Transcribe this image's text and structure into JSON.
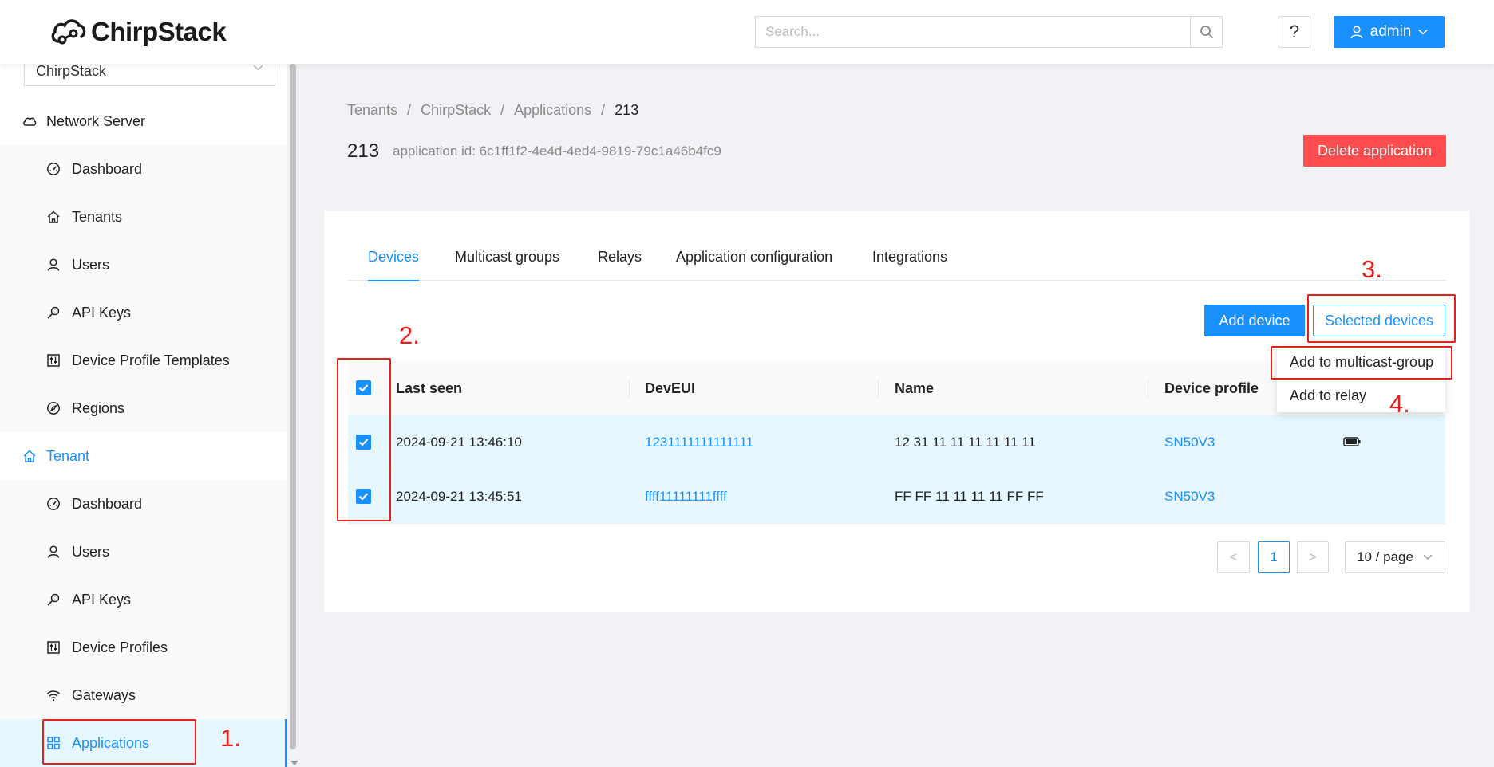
{
  "header": {
    "logo_text": "ChirpStack",
    "search_placeholder": "Search...",
    "help_label": "?",
    "user_label": "admin"
  },
  "sidebar": {
    "tenant_selector": "ChirpStack",
    "network_server_group": "Network Server",
    "network_server_items": [
      {
        "label": "Dashboard",
        "icon": "dashboard-icon"
      },
      {
        "label": "Tenants",
        "icon": "home-icon"
      },
      {
        "label": "Users",
        "icon": "user-icon"
      },
      {
        "label": "API Keys",
        "icon": "key-icon"
      },
      {
        "label": "Device Profile Templates",
        "icon": "control-icon"
      },
      {
        "label": "Regions",
        "icon": "compass-icon"
      }
    ],
    "tenant_group": "Tenant",
    "tenant_items": [
      {
        "label": "Dashboard",
        "icon": "dashboard-icon"
      },
      {
        "label": "Users",
        "icon": "user-icon"
      },
      {
        "label": "API Keys",
        "icon": "key-icon"
      },
      {
        "label": "Device Profiles",
        "icon": "control-icon"
      },
      {
        "label": "Gateways",
        "icon": "wifi-icon"
      },
      {
        "label": "Applications",
        "icon": "appstore-icon",
        "active": true
      }
    ]
  },
  "breadcrumb": [
    "Tenants",
    "/",
    "ChirpStack",
    "/",
    "Applications",
    "/",
    "213"
  ],
  "page": {
    "title": "213",
    "subtitle": "application id: 6c1ff1f2-4e4d-4ed4-9819-79c1a46b4fc9",
    "delete_label": "Delete application"
  },
  "tabs": [
    "Devices",
    "Multicast groups",
    "Relays",
    "Application configuration",
    "Integrations"
  ],
  "toolbar": {
    "add_device_label": "Add device",
    "selected_devices_label": "Selected devices"
  },
  "dropdown": [
    "Add to multicast-group",
    "Add to relay"
  ],
  "table": {
    "columns": [
      "Last seen",
      "DevEUI",
      "Name",
      "Device profile"
    ],
    "rows": [
      {
        "last_seen": "2024-09-21 13:46:10",
        "dev_eui": "1231111111111111",
        "name": "12 31 11 11 11 11 11 11",
        "profile": "SN50V3"
      },
      {
        "last_seen": "2024-09-21 13:45:51",
        "dev_eui": "ffff11111111ffff",
        "name": "FF FF 11 11 11 11 FF FF",
        "profile": "SN50V3"
      }
    ]
  },
  "pagination": {
    "prev": "<",
    "current": "1",
    "next": ">",
    "page_size": "10 / page"
  },
  "annotations": [
    "1.",
    "2.",
    "3.",
    "4."
  ],
  "colors": {
    "accent": "#1890ff",
    "danger": "#ff4d4f",
    "annotation": "#e8201a"
  }
}
